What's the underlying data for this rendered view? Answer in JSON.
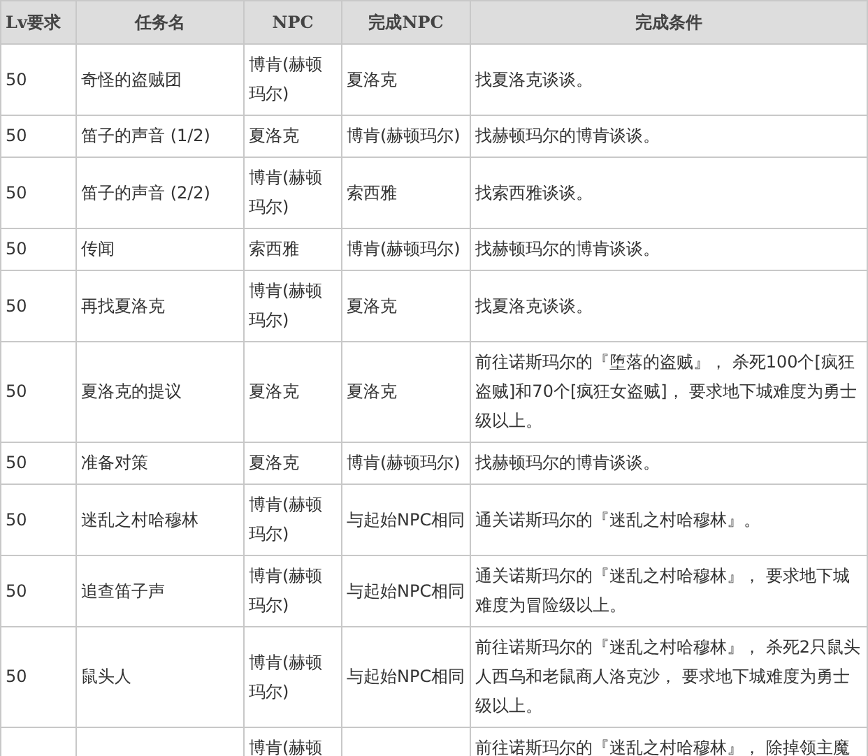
{
  "table": {
    "columns": [
      "Lv要求",
      "任务名",
      "NPC",
      "完成NPC",
      "完成条件"
    ],
    "rows": [
      {
        "cells": [
          "50",
          "奇怪的盗贼团",
          "博肯(赫顿玛尔)",
          "夏洛克",
          "找夏洛克谈谈。"
        ]
      },
      {
        "cells": [
          "50",
          "笛子的声音 (1/2)",
          "夏洛克",
          "博肯(赫顿玛尔)",
          "找赫顿玛尔的博肯谈谈。"
        ]
      },
      {
        "cells": [
          "50",
          "笛子的声音 (2/2)",
          "博肯(赫顿玛尔)",
          "索西雅",
          "找索西雅谈谈。"
        ]
      },
      {
        "cells": [
          "50",
          "传闻",
          "索西雅",
          "博肯(赫顿玛尔)",
          "找赫顿玛尔的博肯谈谈。"
        ]
      },
      {
        "cells": [
          "50",
          "再找夏洛克",
          "博肯(赫顿玛尔)",
          "夏洛克",
          "找夏洛克谈谈。"
        ]
      },
      {
        "cells": [
          "50",
          "夏洛克的提议",
          "夏洛克",
          "夏洛克",
          "前往诺斯玛尔的『堕落的盗贼』， 杀死100个[疯狂盗贼]和70个[疯狂女盗贼]， 要求地下城难度为勇士级以上。"
        ]
      },
      {
        "cells": [
          "50",
          "准备对策",
          "夏洛克",
          "博肯(赫顿玛尔)",
          "找赫顿玛尔的博肯谈谈。"
        ]
      },
      {
        "cells": [
          "50",
          "迷乱之村哈穆林",
          "博肯(赫顿玛尔)",
          "与起始NPC相同",
          "通关诺斯玛尔的『迷乱之村哈穆林』。"
        ]
      },
      {
        "cells": [
          "50",
          "追查笛子声",
          "博肯(赫顿玛尔)",
          "与起始NPC相同",
          "通关诺斯玛尔的『迷乱之村哈穆林』， 要求地下城难度为冒险级以上。"
        ]
      },
      {
        "cells": [
          "50",
          "鼠头人",
          "博肯(赫顿玛尔)",
          "与起始NPC相同",
          "前往诺斯玛尔的『迷乱之村哈穆林』， 杀死2只鼠头人西乌和老鼠商人洛克沙， 要求地下城难度为勇士级以上。"
        ]
      },
      {
        "cells": [
          "",
          "",
          "博肯(赫顿",
          "",
          "前往诺斯玛尔的『迷乱之村哈穆林』， 除掉领主魔"
        ]
      }
    ]
  }
}
